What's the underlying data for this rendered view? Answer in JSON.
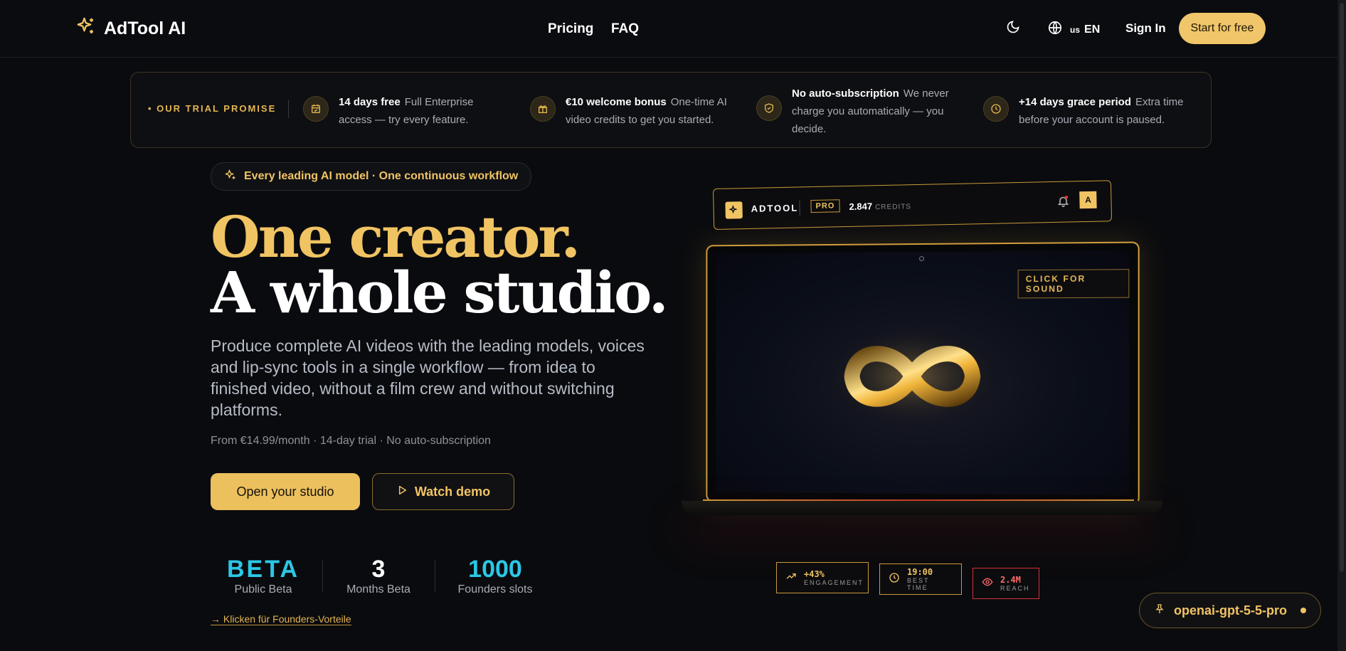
{
  "nav": {
    "brand": "AdTool AI",
    "links": [
      "Pricing",
      "FAQ"
    ],
    "lang_flag": "us",
    "lang_code": "EN",
    "sign_in": "Sign In",
    "cta": "Start for free"
  },
  "promise": {
    "label": "• OUR TRIAL PROMISE",
    "items": [
      {
        "title": "14 days free",
        "text": "Full Enterprise access — try every feature.",
        "icon": "calendar-check-icon"
      },
      {
        "title": "€10 welcome bonus",
        "text": "One-time AI video credits to get you started.",
        "icon": "gift-icon"
      },
      {
        "title": "No auto-subscription",
        "text": "We never charge you automatically — you decide.",
        "icon": "shield-check-icon"
      },
      {
        "title": "+14 days grace period",
        "text": "Extra time before your account is paused.",
        "icon": "clock-icon"
      }
    ]
  },
  "hero": {
    "pill": "Every leading AI model · One continuous workflow",
    "headline_1": "One creator.",
    "headline_2": "A whole studio.",
    "lead": "Produce complete AI videos with the leading models, voices and lip-sync tools in a single workflow — from idea to finished video, without a film crew and without switching platforms.",
    "fineprint": "From €14.99/month · 14-day trial · No auto-subscription",
    "primary_cta": "Open your studio",
    "secondary_cta": "Watch demo",
    "stats": [
      {
        "value": "BETA",
        "label": "Public Beta",
        "color": "#2bc7e6"
      },
      {
        "value": "3",
        "label": "Months Beta",
        "color": "#ffffff"
      },
      {
        "value": "1000",
        "label": "Founders slots",
        "color": "#2bc7e6"
      }
    ],
    "founders_link": "→ Klicken für Founders-Vorteile"
  },
  "mockup": {
    "brand": "ADTOOL",
    "plan": "PRO",
    "credits_value": "2.847",
    "credits_label": "CREDITS",
    "avatar": "A",
    "sound": "CLICK FOR SOUND",
    "chips": [
      {
        "value": "+43%",
        "label": "ENGAGEMENT",
        "icon": "trending-up-icon"
      },
      {
        "value": "19:00",
        "label": "BEST TIME",
        "icon": "clock-icon"
      },
      {
        "value": "2.4M",
        "label": "REACH",
        "icon": "eye-icon"
      }
    ]
  },
  "model_badge": "openai-gpt-5-5-pro",
  "colors": {
    "accent": "#f1c463",
    "background": "#0a0b0e",
    "cyan": "#2bc7e6"
  }
}
